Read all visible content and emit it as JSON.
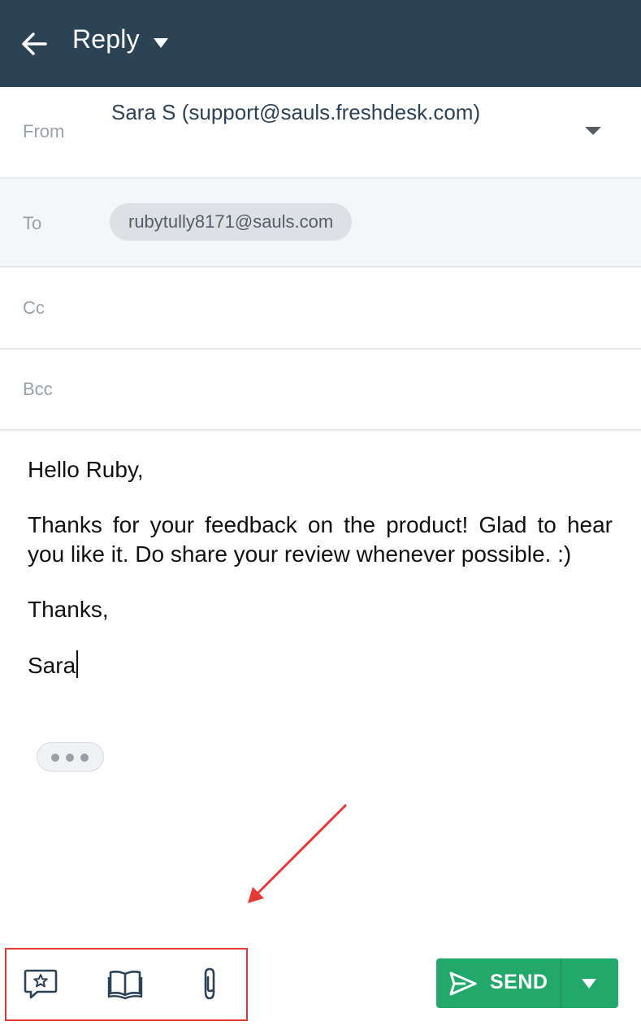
{
  "header": {
    "title": "Reply"
  },
  "from": {
    "label": "From",
    "value": "Sara S (support@sauls.freshdesk.com)"
  },
  "to": {
    "label": "To",
    "chip": "rubytully8171@sauls.com"
  },
  "cc": {
    "label": "Cc"
  },
  "bcc": {
    "label": "Bcc"
  },
  "body": {
    "greeting": "Hello Ruby,",
    "message": "Thanks for your feedback on the product! Glad to hear you like it. Do share your review whenever possible. :)",
    "closing": "Thanks,",
    "signature": "Sara"
  },
  "toolbar": {
    "icons": [
      "canned-response-icon",
      "knowledge-base-icon",
      "attachment-icon"
    ],
    "send_label": "SEND"
  },
  "colors": {
    "header_bg": "#2c4255",
    "send_bg": "#21a86a",
    "annotation": "#e53935"
  }
}
